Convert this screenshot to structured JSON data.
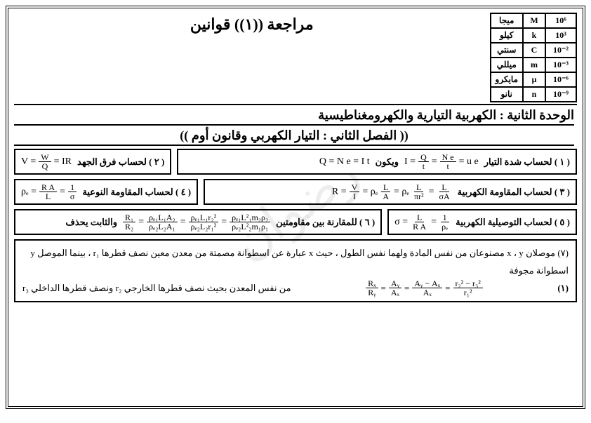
{
  "title": "مراجعة ((١)) قوانين",
  "prefixes": [
    {
      "ar": "ميجا",
      "sym": "M",
      "pow": "10⁶"
    },
    {
      "ar": "كيلو",
      "sym": "k",
      "pow": "10³"
    },
    {
      "ar": "سنتي",
      "sym": "C",
      "pow": "10⁻²"
    },
    {
      "ar": "ميللي",
      "sym": "m",
      "pow": "10⁻³"
    },
    {
      "ar": "مايكرو",
      "sym": "μ",
      "pow": "10⁻⁶"
    },
    {
      "ar": "نانو",
      "sym": "n",
      "pow": "10⁻⁹"
    }
  ],
  "unit_title": "الوحدة الثانية : الكهربية التيارية والكهرومغناطيسية",
  "chapter_title": "(( الفصل الثاني : التيار الكهربي وقانون أوم ))",
  "box1": {
    "label": "( ١ ) لحساب شدة التيار",
    "f1_lhs": "Q = N e = I t",
    "f1_mid": "ويكون",
    "I": "I =",
    "Qt_num": "Q",
    "Qt_den": "t",
    "eq": "=",
    "Ne_num": "N e",
    "Ne_den": "t",
    "tail": "= u e"
  },
  "box2": {
    "label": "( ٢ ) لحساب فرق الجهد",
    "V": "V =",
    "W": "W",
    "Q": "Q",
    "tail": "= IR"
  },
  "box3": {
    "label": "( ٣ ) لحساب المقاومة الكهربية",
    "R": "R =",
    "V": "V",
    "I": "I",
    "eq": "= ρₑ",
    "L": "L",
    "A": "A",
    "eq2": "= ρₑ",
    "L2": "L",
    "pir2": "πr²",
    "eq3": "=",
    "L3": "L",
    "sA": "σA"
  },
  "box4": {
    "label": "( ٤ ) لحساب المقاومة النوعية",
    "rho": "ρₑ =",
    "RA": "R A",
    "L": "L",
    "eq": "=",
    "one": "1",
    "sigma": "σ"
  },
  "box5": {
    "label": "( ٥ ) لحساب التوصيلية الكهربية",
    "sigma": "σ =",
    "L": "L",
    "RA": "R A",
    "eq": "=",
    "one": "1",
    "rho": "ρₑ"
  },
  "box6": {
    "label": "( ٦ ) للمقارنة بين مقاومتين",
    "tail_label": "والثابت يحذف",
    "R1": "R₁",
    "R2": "R₂",
    "n2": "ρₑ₁L₁A₂",
    "d2": "ρₑ₂L₂A₁",
    "n3": "ρₑ₁L₁r₂²",
    "d3": "ρₑ₂L₂r₁²",
    "n4": "ρₑ₁L²₁m₂ρ₂",
    "d4": "ρₑ₂L²₂m₁ρ₁",
    "eq": "="
  },
  "problem": {
    "line1": "(٧) موصلان x ، y مصنوعان من نفس المادة ولهما نفس الطول ، حيث x عبارة عن اسطوانة مصمتة من معدن معين نصف قطرها r₁ ، بينما الموصل y اسطوانة مجوفة",
    "line2_pre": "من نفس المعدن بحيث نصف قطرها الخارجي r₂ ونصف قطرها الداخلي r₃",
    "pageno": "(١)",
    "Rx": "Rₓ",
    "Ry": "Rᵧ",
    "Ay": "Aᵧ",
    "Ax": "Aₓ",
    "AyAx": "Aᵧ − Aₓ",
    "r22r32": "r₂² − r₃²",
    "r12": "r₁²",
    "eq": "="
  },
  "watermark": "رضوان"
}
